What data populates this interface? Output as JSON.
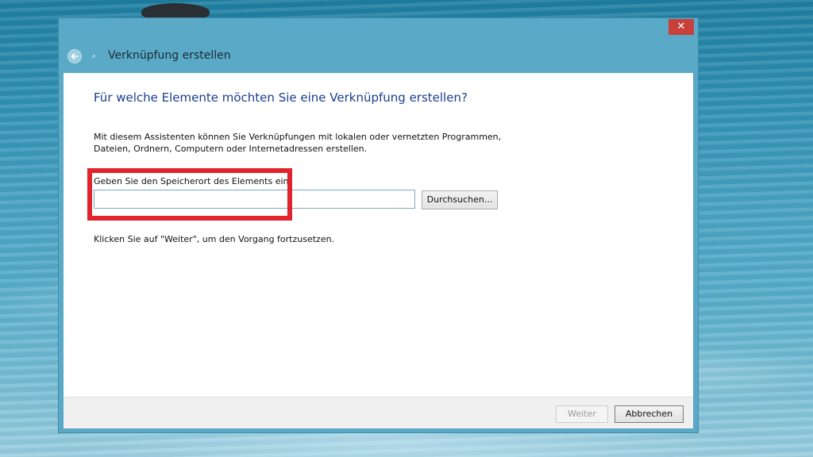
{
  "window": {
    "title": "Verknüpfung erstellen",
    "close_glyph": "✕",
    "back_icon": "back-arrow-icon",
    "title_icon": "shortcut-icon",
    "chrome_color": "#5aaac7",
    "close_color": "#c7403a"
  },
  "wizard": {
    "heading": "Für welche Elemente möchten Sie eine Verknüpfung erstellen?",
    "description": "Mit diesem Assistenten können Sie Verknüpfungen mit lokalen oder vernetzten Programmen, Dateien, Ordnern, Computern oder Internetadressen erstellen.",
    "location_label": "Geben Sie den Speicherort des Elements ein:",
    "location_value": "",
    "browse_label": "Durchsuchen...",
    "hint": "Klicken Sie auf \"Weiter\", um den Vorgang fortzusetzen.",
    "highlight_color": "#e0232c",
    "heading_color": "#1a3e8f"
  },
  "footer": {
    "next_label": "Weiter",
    "cancel_label": "Abbrechen"
  }
}
